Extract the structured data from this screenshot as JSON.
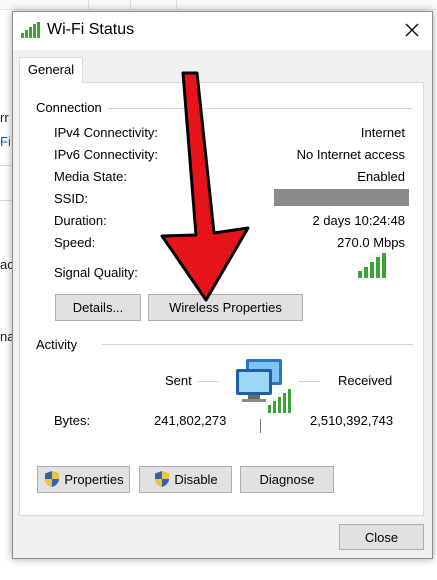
{
  "background": {
    "fragments": [
      {
        "text": "rr",
        "style": "normal"
      },
      {
        "text": "Fi",
        "style": "link"
      },
      {
        "text": "ac",
        "style": "normal"
      },
      {
        "text": "na",
        "style": "normal"
      }
    ]
  },
  "window": {
    "title": "Wi-Fi Status",
    "title_icon": "wifi-signal-icon",
    "close_icon": "close-icon"
  },
  "tabs": [
    {
      "label": "General",
      "selected": true
    }
  ],
  "connection": {
    "heading": "Connection",
    "rows": [
      {
        "label": "IPv4 Connectivity:",
        "value": "Internet"
      },
      {
        "label": "IPv6 Connectivity:",
        "value": "No Internet access"
      },
      {
        "label": "Media State:",
        "value": "Enabled"
      },
      {
        "label": "SSID:",
        "value": ""
      },
      {
        "label": "Duration:",
        "value": "2 days 10:24:48"
      },
      {
        "label": "Speed:",
        "value": "270.0 Mbps"
      }
    ],
    "signal_quality_label": "Signal Quality:",
    "signal_bars": 5
  },
  "buttons": {
    "details": "Details...",
    "wireless_properties": "Wireless Properties",
    "properties": "Properties",
    "disable": "Disable",
    "diagnose": "Diagnose",
    "close": "Close"
  },
  "activity": {
    "heading": "Activity",
    "sent_label": "Sent",
    "received_label": "Received",
    "bytes_label": "Bytes:",
    "bytes_sent": "241,802,273",
    "bytes_received": "2,510,392,743",
    "icon": "network-computers-icon"
  },
  "colors": {
    "arrow": "#e8141b",
    "signal": "#3aa33a",
    "accent": "#0a64c8"
  }
}
